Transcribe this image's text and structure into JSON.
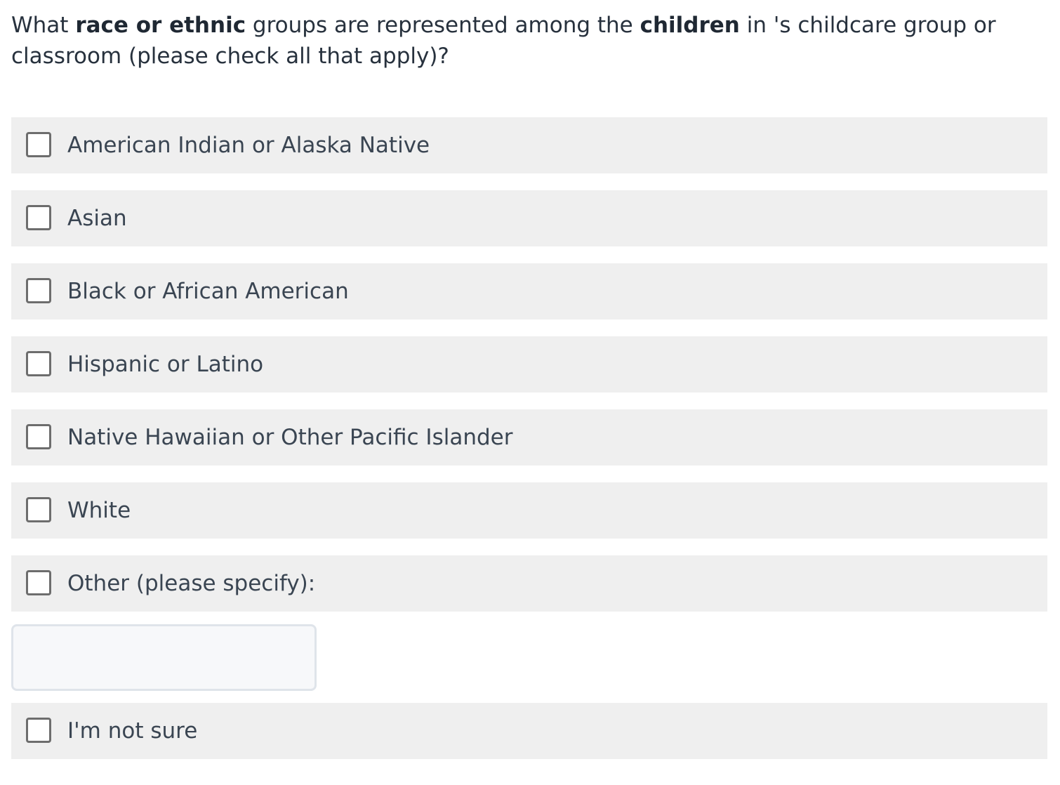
{
  "question": {
    "p1": "What ",
    "b1": "race or ethnic",
    "p2": " groups are represented among the ",
    "b2": "children",
    "p3": " in 's childcare group or classroom (please check all that apply)?"
  },
  "options": [
    {
      "label": "American Indian or Alaska Native",
      "checked": false
    },
    {
      "label": "Asian",
      "checked": false
    },
    {
      "label": "Black or African American",
      "checked": false
    },
    {
      "label": "Hispanic or Latino",
      "checked": false
    },
    {
      "label": "Native Hawaiian or Other Pacific Islander",
      "checked": false
    },
    {
      "label": "White",
      "checked": false
    },
    {
      "label": "Other (please specify):",
      "checked": false
    },
    {
      "label": "I'm not sure",
      "checked": false
    }
  ],
  "other_input": {
    "value": "",
    "placeholder": ""
  },
  "colors": {
    "option_background": "#efefef",
    "checkbox_border": "#6d6d6d",
    "text": "#27313d",
    "input_border": "#dfe4ea",
    "input_background": "#f7f8fa"
  }
}
